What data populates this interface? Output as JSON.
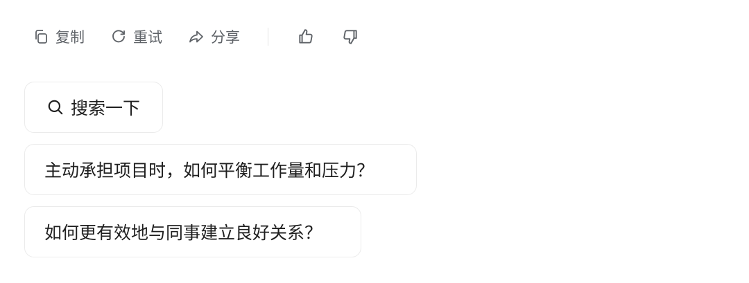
{
  "toolbar": {
    "copy_label": "复制",
    "retry_label": "重试",
    "share_label": "分享"
  },
  "icons": {
    "copy": "copy-icon",
    "retry": "refresh-icon",
    "share": "share-icon",
    "like": "thumbs-up-icon",
    "dislike": "thumbs-down-icon",
    "search": "search-icon"
  },
  "suggestions": {
    "search_label": "搜索一下",
    "items": [
      {
        "label": "主动承担项目时，如何平衡工作量和压力？"
      },
      {
        "label": "如何更有效地与同事建立良好关系？"
      }
    ]
  },
  "colors": {
    "toolbar_text": "#5f6368",
    "card_border": "#ebebeb",
    "text": "#1f1f1f"
  }
}
